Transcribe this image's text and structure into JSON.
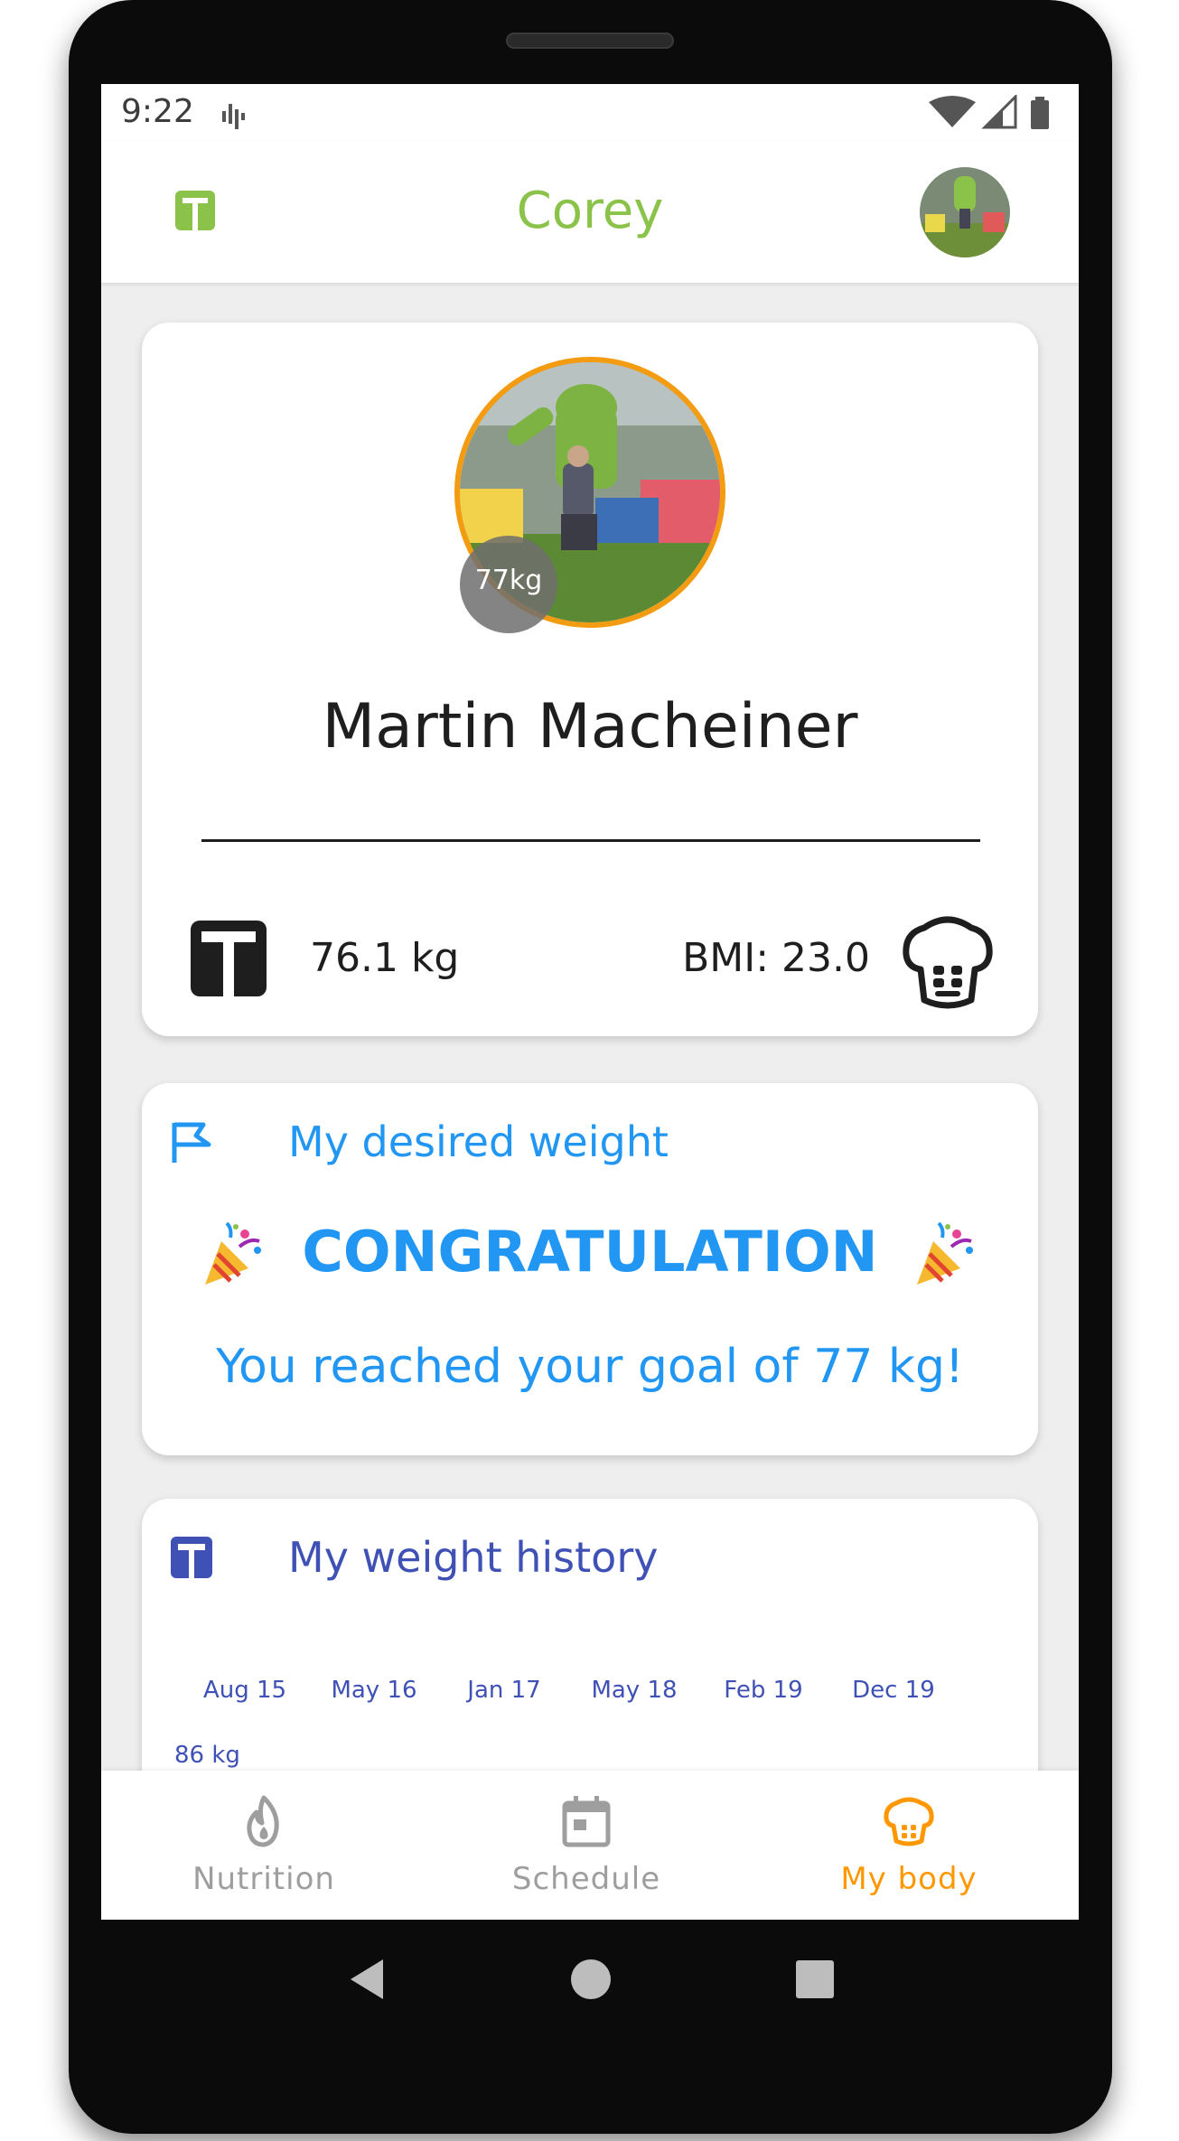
{
  "status_bar": {
    "time": "9:22",
    "icons": [
      "sound-wave-icon",
      "wifi-icon",
      "cellular-signal-icon",
      "battery-icon"
    ]
  },
  "app_bar": {
    "title": "Corey",
    "left_icon": "scale-icon",
    "right_icon": "user-avatar"
  },
  "profile": {
    "weight_bubble": "77kg",
    "name": "Martin Macheiner",
    "weight": "76.1 kg",
    "bmi": "BMI: 23.0",
    "ring_color": "#f39c12"
  },
  "goal": {
    "header": "My desired weight",
    "icon": "flag-icon",
    "congrats": "CONGRATULATION",
    "message": "You reached your goal of 77 kg!",
    "color": "#2196f3"
  },
  "history": {
    "header": "My weight history",
    "icon": "scale-icon",
    "color": "#3f51b5",
    "x_ticks": [
      "Aug 15",
      "May 16",
      "Jan 17",
      "May 18",
      "Feb 19",
      "Dec 19"
    ],
    "y_ticks": [
      "86 kg"
    ]
  },
  "bottom_nav": {
    "items": [
      {
        "label": "Nutrition",
        "icon": "flame-icon",
        "active": false
      },
      {
        "label": "Schedule",
        "icon": "calendar-icon",
        "active": false
      },
      {
        "label": "My body",
        "icon": "muscle-body-icon",
        "active": true
      }
    ],
    "active_color": "#ff9800",
    "inactive_color": "#9e9e9e"
  },
  "system_nav": [
    "back-icon",
    "home-icon",
    "recents-icon"
  ],
  "colors": {
    "brand": "#8bc34a",
    "goal": "#2196f3",
    "history": "#3f51b5",
    "accent": "#ff9800"
  }
}
